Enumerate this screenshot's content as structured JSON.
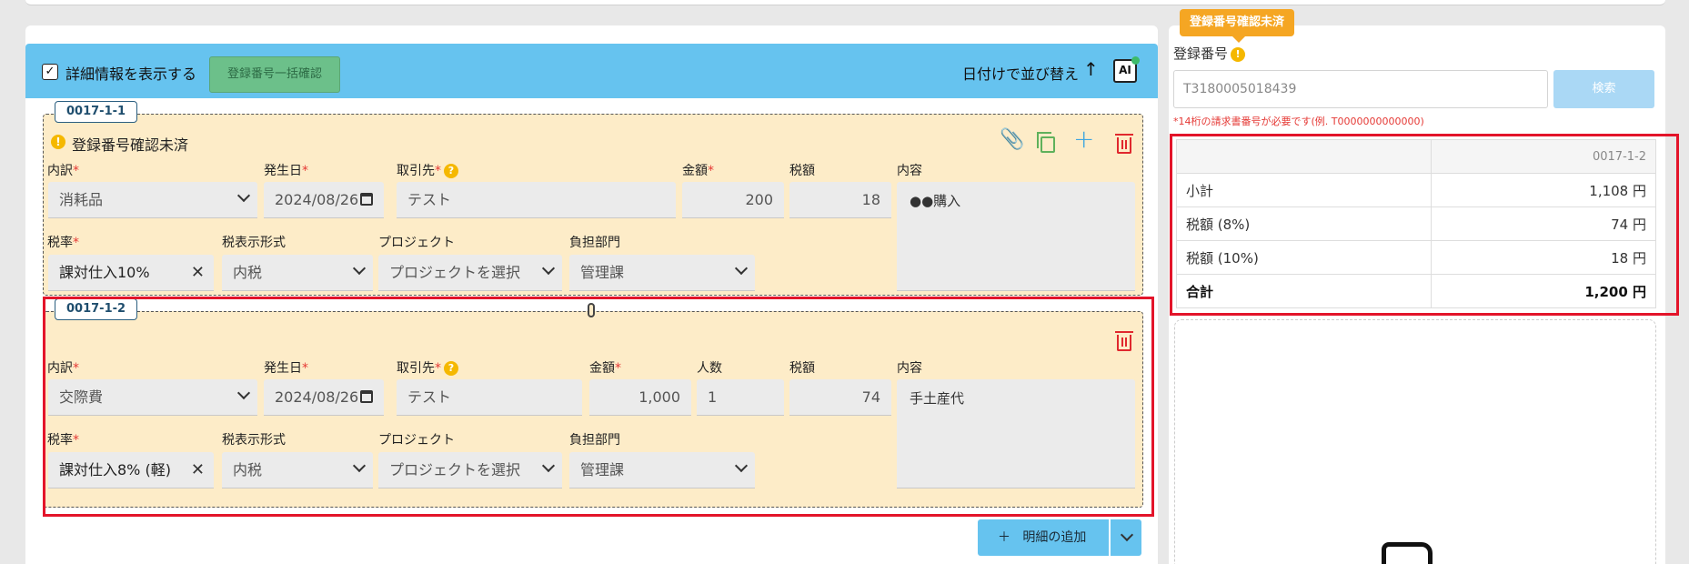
{
  "header": {
    "show_details_label": "詳細情報を表示する",
    "check_mark": "✓",
    "bulk_confirm_label": "登録番号一括確認",
    "sort_label": "日付けで並び替え",
    "sort_arrow": "↑",
    "ai_label": "AI"
  },
  "lines": [
    {
      "tag": "0017-1-1",
      "warning": "登録番号確認未済",
      "category_label": "内訳",
      "category_value": "消耗品",
      "date_label": "発生日",
      "date_value": "2024/08/26",
      "vendor_label": "取引先",
      "vendor_value": "テスト",
      "amount_label": "金額",
      "amount_value": "200",
      "tax_label": "税額",
      "tax_value": "18",
      "content_label": "内容",
      "content_value": "●●購入",
      "taxrate_label": "税率",
      "taxrate_value": "課対仕入10%",
      "taxformat_label": "税表示形式",
      "taxformat_value": "内税",
      "project_label": "プロジェクト",
      "project_value": "プロジェクトを選択",
      "dept_label": "負担部門",
      "dept_value": "管理課"
    },
    {
      "tag": "0017-1-2",
      "category_label": "内訳",
      "category_value": "交際費",
      "date_label": "発生日",
      "date_value": "2024/08/26",
      "vendor_label": "取引先",
      "vendor_value": "テスト",
      "amount_label": "金額",
      "amount_value": "1,000",
      "people_label": "人数",
      "people_value": "1",
      "tax_label": "税額",
      "tax_value": "74",
      "content_label": "内容",
      "content_value": "手土産代",
      "taxrate_label": "税率",
      "taxrate_value": "課対仕入8% (軽)",
      "taxformat_label": "税表示形式",
      "taxformat_value": "内税",
      "project_label": "プロジェクト",
      "project_value": "プロジェクトを選択",
      "dept_label": "負担部門",
      "dept_value": "管理課"
    }
  ],
  "required_mark": "*",
  "help_mark": "?",
  "warn_mark": "!",
  "add_button": {
    "plus": "＋",
    "label": "明細の追加"
  },
  "right": {
    "tooltip": "登録番号確認未済",
    "reg_label": "登録番号",
    "reg_value": "T3180005018439",
    "search_label": "検索",
    "error_text": "*14桁の請求書番号が必要です(例. T0000000000000)",
    "summary": {
      "column": "0017-1-2",
      "rows": [
        {
          "label": "小計",
          "value": "1,108 円"
        },
        {
          "label": "税額 (8%)",
          "value": "74 円"
        },
        {
          "label": "税額 (10%)",
          "value": "18 円"
        },
        {
          "label": "合計",
          "value": "1,200 円"
        }
      ]
    }
  },
  "colors": {
    "accent": "#66c3ef",
    "section_bg": "#fdecc8",
    "highlight": "#e3142a",
    "warning": "#f5b800"
  }
}
